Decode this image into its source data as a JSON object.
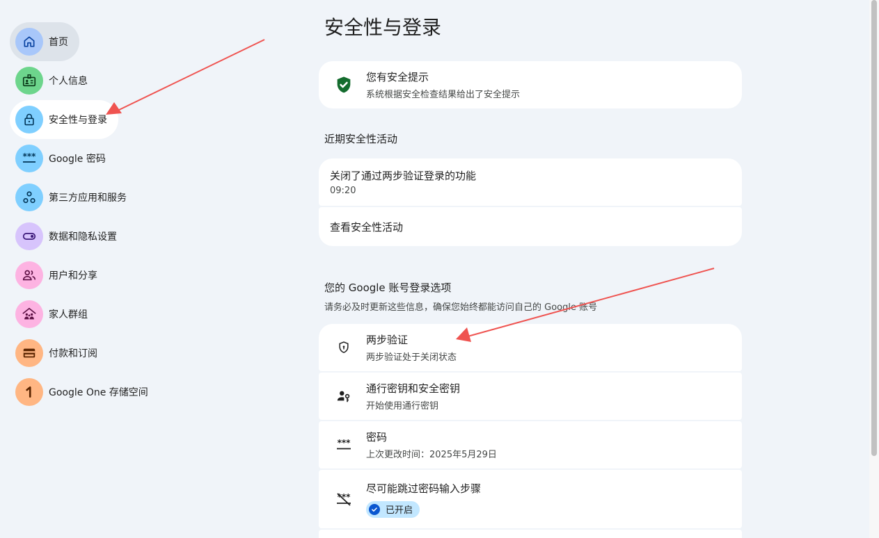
{
  "sidebar": {
    "items": [
      {
        "label": "首页",
        "icon": "home-icon",
        "color": "#a8c7fa"
      },
      {
        "label": "个人信息",
        "icon": "id-card-icon",
        "color": "#6dd58c"
      },
      {
        "label": "安全性与登录",
        "icon": "lock-icon",
        "color": "#7fcfff"
      },
      {
        "label": "Google 密码",
        "icon": "password-icon",
        "color": "#7fcfff"
      },
      {
        "label": "第三方应用和服务",
        "icon": "apps-icon",
        "color": "#7fcfff"
      },
      {
        "label": "数据和隐私设置",
        "icon": "toggle-icon",
        "color": "#d7c4fc"
      },
      {
        "label": "用户和分享",
        "icon": "people-icon",
        "color": "#fdb3e2"
      },
      {
        "label": "家人群组",
        "icon": "family-icon",
        "color": "#fdb3e2"
      },
      {
        "label": "付款和订阅",
        "icon": "wallet-icon",
        "color": "#ffb683"
      },
      {
        "label": "Google One 存储空间",
        "icon": "google-one-icon",
        "color": "#ffb683"
      }
    ]
  },
  "main": {
    "title": "安全性与登录",
    "alert": {
      "title": "您有安全提示",
      "subtitle": "系统根据安全检查结果给出了安全提示"
    },
    "recent": {
      "title": "近期安全性活动",
      "event_title": "关闭了通过两步验证登录的功能",
      "event_time": "09:20",
      "view_link": "查看安全性活动"
    },
    "signin": {
      "title": "您的 Google 账号登录选项",
      "subtitle": "请务必及时更新这些信息，确保您始终都能访问自己的 Google 账号",
      "options": [
        {
          "title": "两步验证",
          "subtitle": "两步验证处于关闭状态"
        },
        {
          "title": "通行密钥和安全密钥",
          "subtitle": "开始使用通行密钥"
        },
        {
          "title": "密码",
          "subtitle": "上次更改时间：2025年5月29日"
        },
        {
          "title": "尽可能跳过密码输入步骤",
          "badge": "已开启"
        }
      ]
    }
  },
  "colors": {
    "accent": "#0b57d0",
    "shield": "#146c2e",
    "arrow": "#ef5350"
  }
}
